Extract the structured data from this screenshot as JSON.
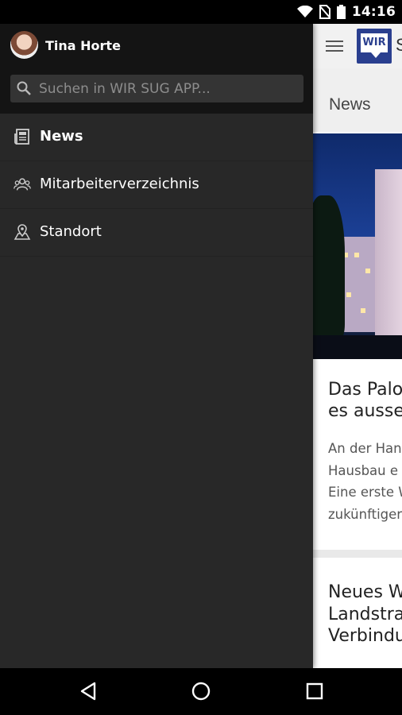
{
  "status_bar": {
    "time": "14:16",
    "icons": [
      "wifi-icon",
      "no-sim-icon",
      "battery-icon"
    ]
  },
  "drawer": {
    "user_name": "Tina Horte",
    "search_placeholder": "Suchen in WIR SUG APP...",
    "menu_items": [
      {
        "label": "News",
        "icon": "newspaper-icon",
        "active": true
      },
      {
        "label": "Mitarbeiterverzeichnis",
        "icon": "people-icon",
        "active": false
      },
      {
        "label": "Standort",
        "icon": "map-pin-icon",
        "active": false
      }
    ]
  },
  "app": {
    "logo_text": "WIR",
    "title_fragment": "S",
    "section_title": "News",
    "card1_title": "Das Palo\nes ausse",
    "card1_text": "An der Han\nHausbau e\nEine erste W\nzukünftiger",
    "card2_title": "Neues W\nLandstra\nVerbindu"
  },
  "colors": {
    "drawer_bg": "#282828",
    "drawer_header_bg": "#141414",
    "logo_blue": "#2a3f8f"
  }
}
